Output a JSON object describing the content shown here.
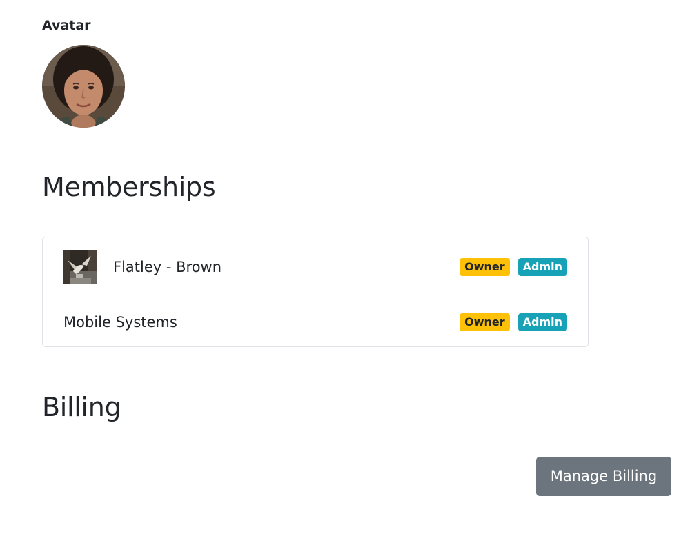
{
  "avatar": {
    "label": "Avatar"
  },
  "memberships": {
    "heading": "Memberships",
    "items": [
      {
        "name": "Flatley - Brown",
        "has_thumbnail": true,
        "badges": [
          "Owner",
          "Admin"
        ]
      },
      {
        "name": "Mobile Systems",
        "has_thumbnail": false,
        "badges": [
          "Owner",
          "Admin"
        ]
      }
    ]
  },
  "billing": {
    "heading": "Billing",
    "button_label": "Manage Billing"
  },
  "colors": {
    "owner_badge": "#ffc107",
    "admin_badge": "#17a2b8",
    "secondary_button": "#6c757d",
    "text": "#212529",
    "border": "#dee2e6"
  }
}
